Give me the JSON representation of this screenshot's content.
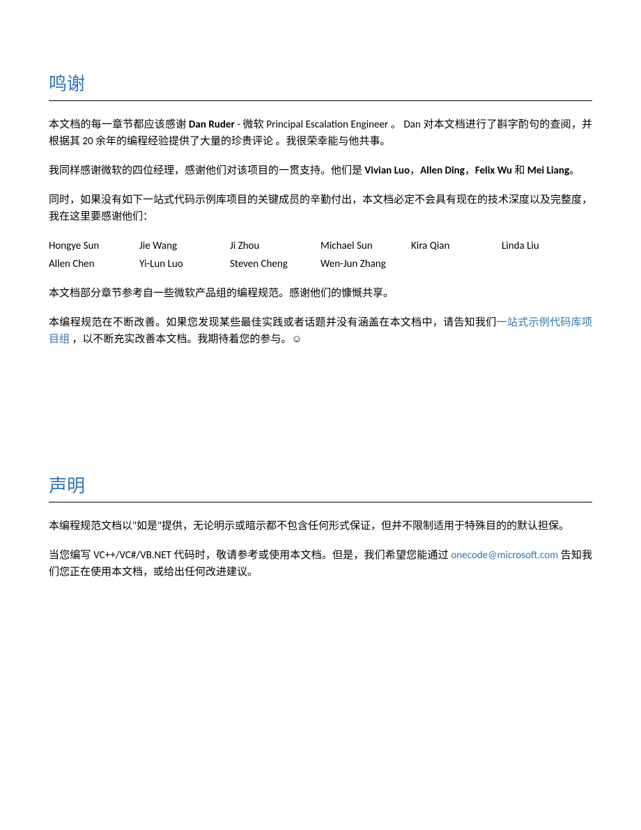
{
  "acknowledgements": {
    "heading": "鸣谢",
    "p1_prefix": "本文档的每一章节都应该感谢 ",
    "p1_name": "Dan Ruder",
    "p1_suffix": " - 微软 Principal Escalation Engineer 。 Dan 对本文档进行了斟字酌句的查阅，并根据其 20 余年的编程经验提供了大量的珍贵评论 。我很荣幸能与他共事。",
    "p2_prefix": "我同样感谢微软的四位经理，感谢他们对该项目的一贯支持。他们是 ",
    "p2_n1": "Vivian Luo",
    "p2_c1": "，",
    "p2_n2": "Allen Ding",
    "p2_c2": "，",
    "p2_n3": "Felix Wu",
    "p2_c3": " 和 ",
    "p2_n4": "Mei Liang",
    "p2_end": "。",
    "p3": "同时，如果没有如下一站式代码示例库项目的关键成员的辛勤付出，本文档必定不会具有现在的技术深度以及完整度，我在这里要感谢他们：",
    "contributors": [
      "Hongye Sun",
      "Jie Wang",
      "Ji Zhou",
      "Michael Sun",
      "Kira Qian",
      "Linda Liu",
      "Allen Chen",
      "Yi-Lun Luo",
      "Steven Cheng",
      "Wen-Jun Zhang"
    ],
    "p4": "本文档部分章节参考自一些微软产品组的编程规范。感谢他们的慷慨共享。",
    "p5_prefix": "本编程规范在不断改善。如果您发现某些最佳实践或者话题并没有涵盖在本文档中，请告知我们",
    "p5_link": "一站式示例代码库项目组",
    "p5_suffix": " ，以不断充实改善本文档。我期待着您的参与。",
    "p5_smiley": "☺"
  },
  "disclaimer": {
    "heading": "声明",
    "p1": "本编程规范文档以\"如是\"提供，无论明示或暗示都不包含任何形式保证，但并不限制适用于特殊目的的默认担保。",
    "p2_prefix": "当您编写 VC++/VC#/VB.NET 代码时，敬请参考或使用本文档。但是，我们希望您能通过 ",
    "p2_email": "onecode@microsoft.com",
    "p2_suffix": " 告知我们您正在使用本文档，或给出任何改进建议。"
  }
}
